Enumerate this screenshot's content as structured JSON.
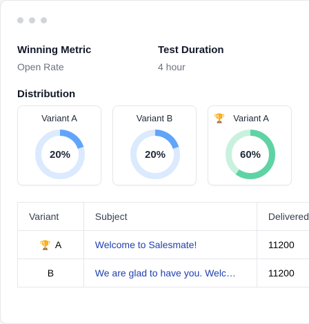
{
  "meta": {
    "winning_metric_label": "Winning Metric",
    "winning_metric_value": "Open Rate",
    "test_duration_label": "Test Duration",
    "test_duration_value": "4 hour"
  },
  "distribution": {
    "title": "Distribution",
    "cards": [
      {
        "name": "Variant A",
        "percent": 20,
        "percent_label": "20%",
        "winner": false,
        "color": "#60a5fa",
        "track": "#dbeafe"
      },
      {
        "name": "Variant B",
        "percent": 20,
        "percent_label": "20%",
        "winner": false,
        "color": "#60a5fa",
        "track": "#dbeafe"
      },
      {
        "name": "Variant A",
        "percent": 60,
        "percent_label": "60%",
        "winner": true,
        "color": "#5fd3a3",
        "track": "#c9f1df"
      }
    ]
  },
  "table": {
    "headers": [
      "Variant",
      "Subject",
      "Delivered"
    ],
    "rows": [
      {
        "variant": "A",
        "winner": true,
        "subject": "Welcome to Salesmate!",
        "delivered": "11200"
      },
      {
        "variant": "B",
        "winner": false,
        "subject": "We are glad to have you. Welcome to Salesmate!",
        "delivered": "11200"
      }
    ]
  }
}
